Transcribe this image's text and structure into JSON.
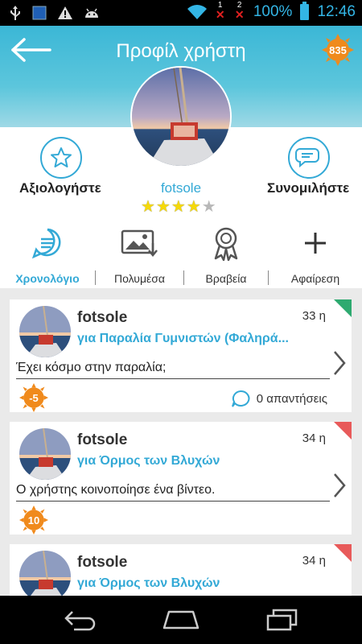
{
  "status_bar": {
    "battery": "100%",
    "time": "12:46",
    "sim1": "1",
    "sim2": "2"
  },
  "header": {
    "title": "Προφίλ χρήστη",
    "points": "835"
  },
  "profile": {
    "username": "fotsole",
    "rating": 4,
    "rating_max": 5,
    "rate_label": "Αξιολογήστε",
    "chat_label": "Συνομιλήστε"
  },
  "tabs": [
    {
      "label": "Χρονολόγιο",
      "icon": "timeline-icon",
      "active": true
    },
    {
      "label": "Πολυμέσα",
      "icon": "media-icon",
      "active": false
    },
    {
      "label": "Βραβεία",
      "icon": "award-icon",
      "active": false
    },
    {
      "label": "Αφαίρεση",
      "icon": "plus-icon",
      "active": false
    }
  ],
  "feed": [
    {
      "author": "fotsole",
      "place": "για Παραλία Γυμνιστών (Φαληρά...",
      "age": "33 η",
      "message": "Έχει κόσμο στην παραλία;",
      "score": "-5",
      "replies": "0 απαντήσεις",
      "corner_color": "#2eaa70"
    },
    {
      "author": "fotsole",
      "place": "για Όρμος των Βλυχών",
      "age": "34 η",
      "message": "Ο χρήστης κοινοποίησε ένα βίντεο.",
      "score": "10",
      "corner_color": "#e85a5a"
    },
    {
      "author": "fotsole",
      "place": "για Όρμος των Βλυχών",
      "age": "34 η",
      "corner_color": "#e85a5a"
    }
  ],
  "colors": {
    "accent": "#33a9d6",
    "badge": "#f08a1c",
    "star": "#f5d90a"
  }
}
